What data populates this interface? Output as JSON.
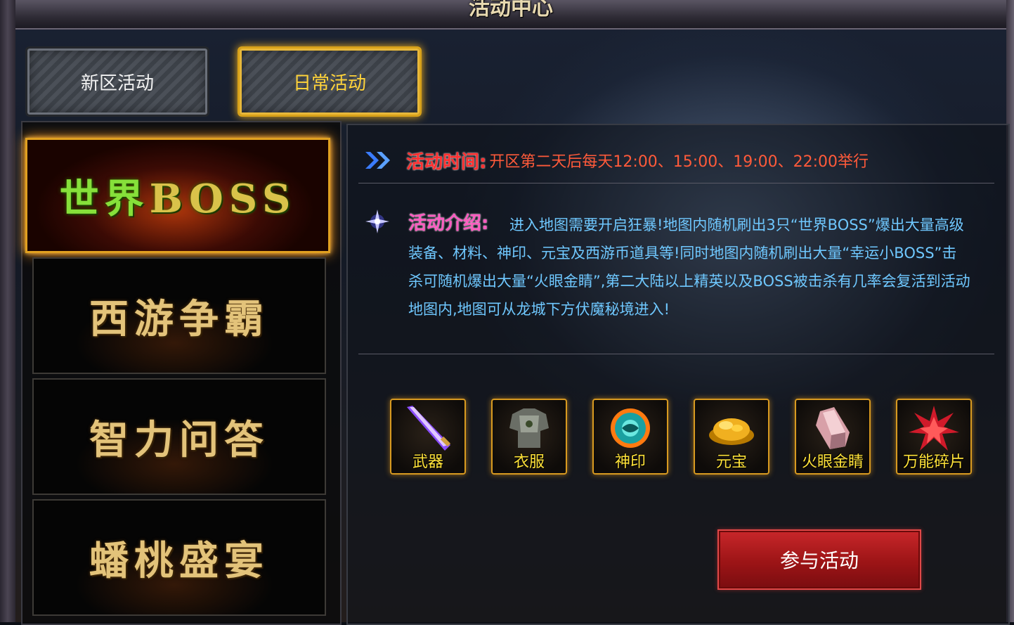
{
  "window": {
    "title": "活动中心"
  },
  "tabs": [
    {
      "label": "新区活动",
      "active": false
    },
    {
      "label": "日常活动",
      "active": true
    }
  ],
  "activities": [
    {
      "name_cn": "世界",
      "name_en": "BOSS",
      "selected": true
    },
    {
      "name": "西游争霸",
      "selected": false
    },
    {
      "name": "智力问答",
      "selected": false
    },
    {
      "name": "蟠桃盛宴",
      "selected": false
    }
  ],
  "details": {
    "time_label": "活动时间:",
    "time_text": "开区第二天后每天12:00、15:00、19:00、22:00举行",
    "intro_label": "活动介绍:",
    "intro_text": "进入地图需要开启狂暴!地图内随机刷出3只“世界BOSS”爆出大量高级装备、材料、神印、元宝及西游币道具等!同时地图内随机刷出大量“幸运小BOSS”击杀可随机爆出大量“火眼金睛”,第二大陆以上精英以及BOSS被击杀有几率会复活到活动地图内,地图可从龙城下方伏魔秘境进入!"
  },
  "rewards": [
    {
      "name": "武器",
      "icon": "sword-icon"
    },
    {
      "name": "衣服",
      "icon": "armor-icon"
    },
    {
      "name": "神印",
      "icon": "seal-orb-icon"
    },
    {
      "name": "元宝",
      "icon": "gold-ingot-icon"
    },
    {
      "name": "火眼金睛",
      "icon": "crystal-icon"
    },
    {
      "name": "万能碎片",
      "icon": "shard-star-icon"
    }
  ],
  "join_button": {
    "label": "参与活动"
  },
  "colors": {
    "time_label": "#ff3030",
    "intro_label": "#ff5ac0",
    "intro_text": "#6fc8ff",
    "reward_name": "#ffe23a",
    "active_tab": "#ffd33a"
  }
}
